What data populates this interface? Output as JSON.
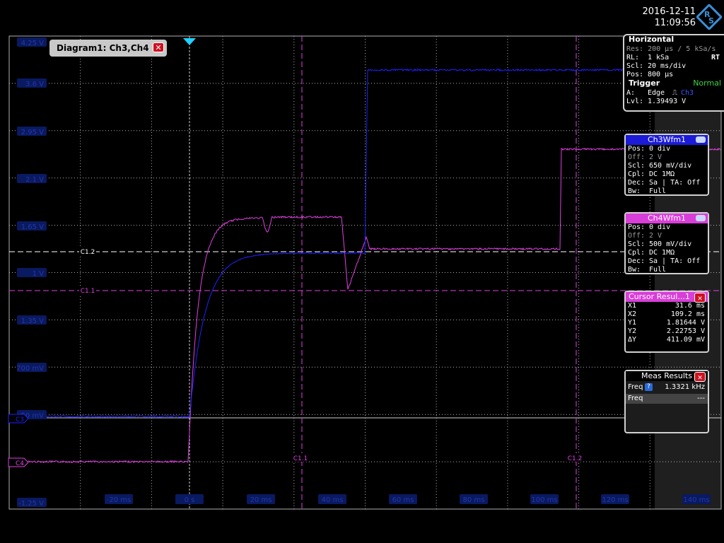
{
  "datetime": {
    "date": "2016-12-11",
    "time": "11:09:56"
  },
  "colors": {
    "ch3": "#2020ff",
    "ch4": "#e040e0",
    "grid": "#b0b0b0",
    "panel_bg": "#000000"
  },
  "diagram_label": {
    "title": "Diagram1: Ch3,Ch4",
    "close_icon": "close-icon"
  },
  "y_labels": [
    "4.25 V",
    "3.6 V",
    "2.95 V",
    "2.1 V",
    "1.65 V",
    "1 V",
    "1.35 V",
    "700 mV",
    "50 mV",
    "-1.25 V"
  ],
  "x_labels": [
    "-20 ms",
    "0 s",
    "20 ms",
    "40 ms",
    "60 ms",
    "80 ms",
    "100 ms",
    "120 ms",
    "140 ms"
  ],
  "cursors": {
    "h1": "C1.1",
    "h2": "C1.2",
    "v1": "C1.1",
    "v2": "C1.2"
  },
  "channel_markers": {
    "ch3": "C3",
    "ch4": "C4"
  },
  "horizontal": {
    "title": "Horizontal",
    "res": "Res: 200 µs / 5 kSa/s",
    "rl_label": "RL:",
    "rl_value": "1 kSa",
    "rl_mode": "RT",
    "scl_label": "Scl:",
    "scl_value": "20 ms/div",
    "pos_label": "Pos:",
    "pos_value": "800 µs",
    "trigger_title": "Trigger",
    "trigger_mode": "Normal",
    "a_label": "A:",
    "a_value": "Edge",
    "a_source": "Ch3",
    "lvl_label": "Lvl:",
    "lvl_value": "1.39493 V"
  },
  "ch3": {
    "title": "Ch3Wfm1",
    "rows": [
      {
        "label": "Pos:",
        "value": "0 div"
      },
      {
        "label": "Off:",
        "value": "2 V"
      },
      {
        "label": "Scl:",
        "value": "650 mV/div"
      },
      {
        "label": "Cpl:",
        "value": "DC 1MΩ"
      },
      {
        "label": "Dec:",
        "value": "Sa | TA: Off"
      },
      {
        "label": "Bw:",
        "value": "Full"
      }
    ]
  },
  "ch4": {
    "title": "Ch4Wfm1",
    "rows": [
      {
        "label": "Pos:",
        "value": "0 div"
      },
      {
        "label": "Off:",
        "value": "2 V"
      },
      {
        "label": "Scl:",
        "value": "500 mV/div"
      },
      {
        "label": "Cpl:",
        "value": "DC 1MΩ"
      },
      {
        "label": "Dec:",
        "value": "Sa | TA: Off"
      },
      {
        "label": "Bw:",
        "value": "Full"
      }
    ]
  },
  "cursor_results": {
    "title": "Cursor Resul...1",
    "rows": [
      {
        "label": "X1",
        "value": "31.6 ms"
      },
      {
        "label": "X2",
        "value": "109.2 ms"
      },
      {
        "label": "Y1",
        "value": "1.81644 V"
      },
      {
        "label": "Y2",
        "value": "2.22753 V"
      },
      {
        "label": "ΔY",
        "value": "411.09 mV"
      }
    ]
  },
  "meas_results": {
    "title": "Meas Results",
    "rows": [
      {
        "label": "Freq",
        "value": "1.3321 kHz"
      },
      {
        "label": "Freq",
        "value": "---"
      }
    ]
  }
}
